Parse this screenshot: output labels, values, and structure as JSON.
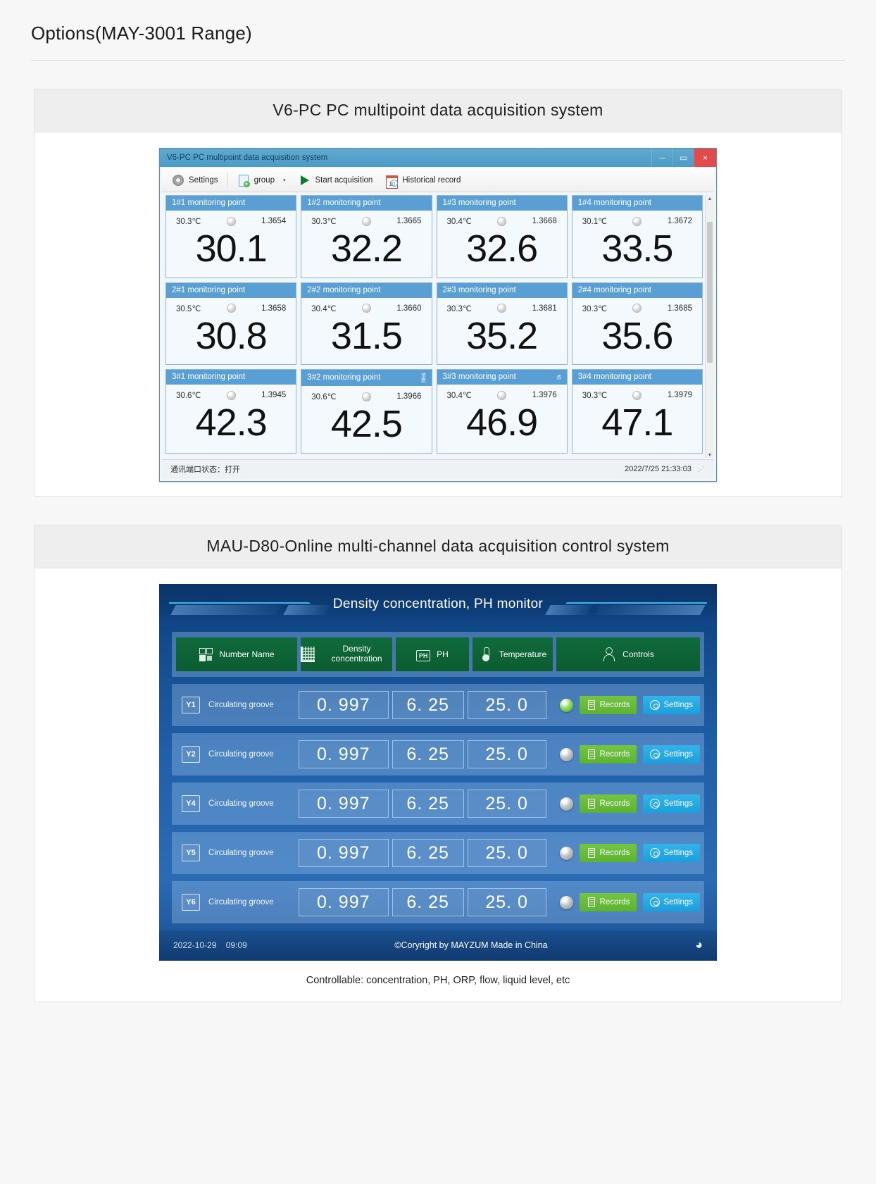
{
  "page": {
    "title": "Options(MAY-3001 Range)"
  },
  "v6": {
    "card_title": "V6-PC PC multipoint data acquisition system",
    "window_title": "V6-PC PC multipoint data acquisition system",
    "window_buttons": {
      "minimize": "─",
      "maximize": "▭",
      "close": "×"
    },
    "toolbar": {
      "settings": "Settings",
      "group": "group",
      "caret": "▾",
      "start": "Start acquisition",
      "history": "Historical record"
    },
    "points": [
      [
        {
          "title": "1#1 monitoring point",
          "temp": "30.3℃",
          "index": "1.3654",
          "value": "30.1",
          "cn": ""
        },
        {
          "title": "1#2 monitoring point",
          "temp": "30.3℃",
          "index": "1.3665",
          "value": "32.2",
          "cn": ""
        },
        {
          "title": "1#3 monitoring point",
          "temp": "30.4℃",
          "index": "1.3668",
          "value": "32.6",
          "cn": ""
        },
        {
          "title": "1#4 monitoring point",
          "temp": "30.1℃",
          "index": "1.3672",
          "value": "33.5",
          "cn": ""
        }
      ],
      [
        {
          "title": "2#1 monitoring point",
          "temp": "30.5℃",
          "index": "1.3658",
          "value": "30.8",
          "cn": ""
        },
        {
          "title": "2#2 monitoring point",
          "temp": "30.4℃",
          "index": "1.3660",
          "value": "31.5",
          "cn": ""
        },
        {
          "title": "2#3 monitoring point",
          "temp": "30.3℃",
          "index": "1.3681",
          "value": "35.2",
          "cn": ""
        },
        {
          "title": "2#4 monitoring point",
          "temp": "30.3℃",
          "index": "1.3685",
          "value": "35.6",
          "cn": ""
        }
      ],
      [
        {
          "title": "3#1 monitoring point",
          "temp": "30.6℃",
          "index": "1.3945",
          "value": "42.3",
          "cn": ""
        },
        {
          "title": "3#2 monitoring point",
          "temp": "30.6℃",
          "index": "1.3966",
          "value": "42.5",
          "cn": "浓度"
        },
        {
          "title": "3#3 monitoring point",
          "temp": "30.4℃",
          "index": "1.3976",
          "value": "46.9",
          "cn": "浓"
        },
        {
          "title": "3#4 monitoring point",
          "temp": "30.3℃",
          "index": "1.3979",
          "value": "47.1",
          "cn": ""
        }
      ]
    ],
    "status": {
      "left": "通讯端口状态：打开",
      "right": "2022/7/25 21:33:03",
      "grip": "⋰"
    }
  },
  "mau": {
    "card_title": "MAU-D80-Online multi-channel data acquisition control system",
    "banner_title": "Density concentration, PH monitor",
    "headers": [
      {
        "label": "Number Name",
        "icon": "grid-icon"
      },
      {
        "label": "Density concentration",
        "icon": "density-icon"
      },
      {
        "label": "PH",
        "icon": "ph-icon"
      },
      {
        "label": "Temperature",
        "icon": "thermometer-icon"
      },
      {
        "label": "Controls",
        "icon": "controls-icon"
      }
    ],
    "rows": [
      {
        "tag": "Y1",
        "name": "Circulating groove",
        "density": "0. 997",
        "ph": "6. 25",
        "temp": "25. 0",
        "led": "on",
        "records": "Records",
        "settings": "Settings"
      },
      {
        "tag": "Y2",
        "name": "Circulating groove",
        "density": "0. 997",
        "ph": "6. 25",
        "temp": "25. 0",
        "led": "off",
        "records": "Records",
        "settings": "Settings"
      },
      {
        "tag": "Y4",
        "name": "Circulating groove",
        "density": "0. 997",
        "ph": "6. 25",
        "temp": "25. 0",
        "led": "off",
        "records": "Records",
        "settings": "Settings"
      },
      {
        "tag": "Y5",
        "name": "Circulating groove",
        "density": "0. 997",
        "ph": "6. 25",
        "temp": "25. 0",
        "led": "off",
        "records": "Records",
        "settings": "Settings"
      },
      {
        "tag": "Y6",
        "name": "Circulating groove",
        "density": "0. 997",
        "ph": "6. 25",
        "temp": "25. 0",
        "led": "off",
        "records": "Records",
        "settings": "Settings"
      }
    ],
    "footer": {
      "date": "2022-10-29",
      "time": "09:09",
      "copyright": "©Coryright by MAYZUM  Made in China",
      "wifi": "\u0001"
    },
    "caption": "Controllable: concentration, PH, ORP, flow, liquid level, etc"
  },
  "colors": {
    "accent_blue": "#5a9fd4",
    "hmi_green": "#0f6b3a",
    "records_green": "#5cb32f",
    "settings_blue": "#1ba0dc",
    "close_red": "#e04b4b"
  }
}
